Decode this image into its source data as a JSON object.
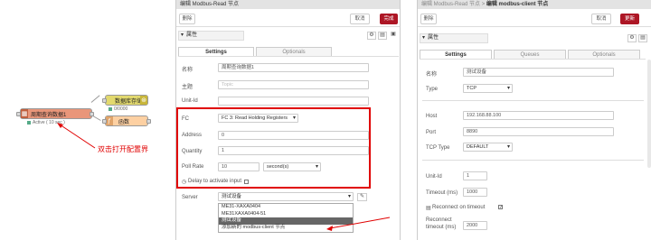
{
  "flow": {
    "inject_node": "周期查询数据1",
    "status_text": "Active ( 10 sec )",
    "db_node": "数据库存储",
    "db_status": "0/0000",
    "func_node": "函数",
    "annotation": "双击打开配置界"
  },
  "modbus_read": {
    "breadcrumb": "编辑 Modbus-Read 节点",
    "delete_label": "删除",
    "cancel_label": "取消",
    "done_label": "完成",
    "properties_label": "属性",
    "tabs": [
      "Settings",
      "Optionals"
    ],
    "name_label": "名称",
    "name_value": "周期查询数据1",
    "topic_label": "主题",
    "topic_placeholder": "Topic",
    "unit_id_label": "Unit-Id",
    "fc_label": "FC",
    "fc_value": "FC 3: Read Holding Registers",
    "address_label": "Address",
    "address_value": "0",
    "quantity_label": "Quantity",
    "quantity_value": "1",
    "poll_rate_label": "Poll Rate",
    "poll_rate_value": "10",
    "poll_rate_unit": "second(s)",
    "delay_label": "Delay to activate input",
    "server_label": "Server",
    "server_value": "测试设备",
    "server_options": [
      "ME31-XAXA0404",
      "ME31XAXA0404-51",
      "测试设备",
      "添加新的 modbus-client 节点"
    ]
  },
  "modbus_client": {
    "breadcrumb_prefix": "编辑 Modbus-Read 节点 > ",
    "breadcrumb_current": "编辑 modbus-client 节点",
    "delete_label": "删除",
    "cancel_label": "取消",
    "update_label": "更新",
    "properties_label": "属性",
    "tabs": [
      "Settings",
      "Queues",
      "Optionals"
    ],
    "name_label": "名称",
    "name_value": "测试设备",
    "type_label": "Type",
    "type_value": "TCP",
    "host_label": "Host",
    "host_value": "192.168.88.100",
    "port_label": "Port",
    "port_value": "8890",
    "tcp_type_label": "TCP Type",
    "tcp_type_value": "DEFAULT",
    "unit_id_label": "Unit-Id",
    "unit_id_value": "1",
    "timeout_label": "Timeout (ms)",
    "timeout_value": "1000",
    "reconnect_label": "Reconnect on timeout",
    "reconnect_timeout_label_1": "Reconnect",
    "reconnect_timeout_label_2": "timeout (ms)",
    "reconnect_timeout_value": "2000"
  },
  "colors": {
    "accent_red": "#e00000",
    "primary_button": "#ad1625",
    "inject_node": "#e9967a",
    "db_node": "#e2d96e",
    "func_node": "#fdd0a2",
    "status_green": "#5a8"
  }
}
